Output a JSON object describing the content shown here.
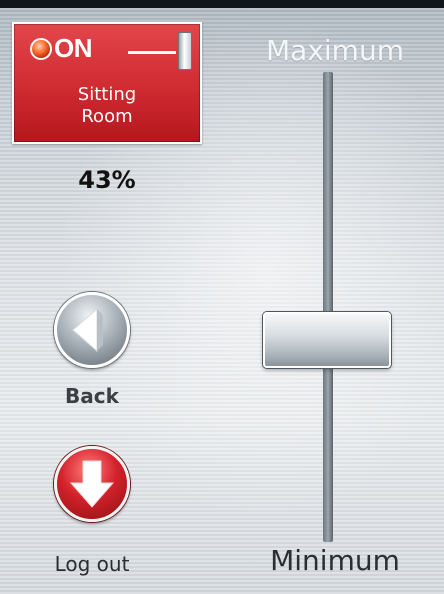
{
  "device": {
    "state_label": "ON",
    "room_name": "Sitting\nRoom",
    "level_text": "43%",
    "level_percent": 43,
    "led_color": "#ff6a2a",
    "tile_color": "#cf2b31"
  },
  "slider": {
    "max_label": "Maximum",
    "min_label": "Minimum"
  },
  "buttons": {
    "back_label": "Back",
    "back_icon": "play-left-icon",
    "logout_label": "Log out",
    "logout_icon": "arrow-down-icon",
    "logout_color": "#d3222a"
  }
}
